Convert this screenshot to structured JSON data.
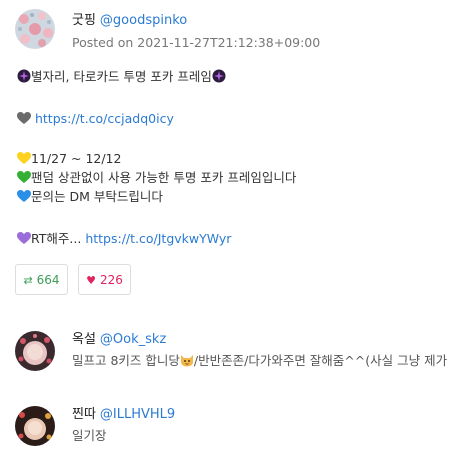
{
  "posts": [
    {
      "display_name": "굿핑",
      "handle": "@goodspinko",
      "posted": "Posted on 2021-11-27T21:12:38+09:00",
      "lines": {
        "title": "별자리, 타로카드 투명 포카 프레임",
        "link1": "https://t.co/ccjadq0icy",
        "dates": "11/27 ~ 12/12",
        "note1": "팬덤 상관없이 사용 가능한 투명 포카 프레임입니다",
        "note2": "문의는 DM 부탁드립니다",
        "rt_text": "RT해주...",
        "link2": "https://t.co/JtgvkwYWyr"
      },
      "retweets": "664",
      "likes": "226",
      "retweet_icon": "retweet-icon",
      "like_icon": "heart-icon"
    },
    {
      "display_name": "옥설",
      "handle": "@Ook_skz",
      "snippet_a": "밀프고 8키즈 합니당",
      "snippet_b": "/반반존존/다가와주면 잘해줌^^(사실 그냥 제가",
      "emoji": "cat-face-icon"
    },
    {
      "display_name": "찐따",
      "handle": "@ILLHVHL9",
      "snippet": "일기장"
    }
  ],
  "colors": {
    "link": "#2b7bd3",
    "retweet": "#3a9d57",
    "like": "#e0245e",
    "muted": "#777777"
  }
}
